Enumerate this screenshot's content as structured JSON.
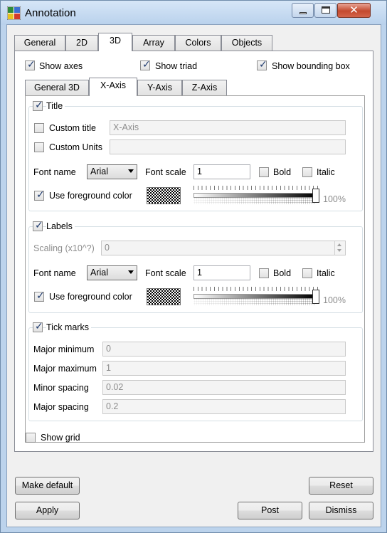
{
  "window": {
    "title": "Annotation",
    "close_symbol": "✕"
  },
  "outer_tabs": [
    "General",
    "2D",
    "3D",
    "Array",
    "Colors",
    "Objects"
  ],
  "show_axes": {
    "label": "Show axes",
    "checked": true
  },
  "show_triad": {
    "label": "Show triad",
    "checked": true
  },
  "show_bbox": {
    "label": "Show bounding box",
    "checked": true
  },
  "inner_tabs": [
    "General 3D",
    "X-Axis",
    "Y-Axis",
    "Z-Axis"
  ],
  "title_group": {
    "label": "Title",
    "custom_title_label": "Custom title",
    "custom_title_value": "X-Axis",
    "custom_units_label": "Custom Units",
    "custom_units_value": "",
    "font_name_label": "Font name",
    "font_name_value": "Arial",
    "font_scale_label": "Font scale",
    "font_scale_value": "1",
    "bold_label": "Bold",
    "italic_label": "Italic",
    "use_fg_label": "Use foreground color",
    "opacity_text": "100%",
    "opacity_value": 1.0
  },
  "labels_group": {
    "label": "Labels",
    "scaling_label": "Scaling (x10^?)",
    "scaling_value": "0",
    "font_name_label": "Font name",
    "font_name_value": "Arial",
    "font_scale_label": "Font scale",
    "font_scale_value": "1",
    "bold_label": "Bold",
    "italic_label": "Italic",
    "use_fg_label": "Use foreground color",
    "opacity_text": "100%",
    "opacity_value": 1.0
  },
  "tick_group": {
    "label": "Tick marks",
    "major_min_label": "Major minimum",
    "major_min_value": "0",
    "major_max_label": "Major maximum",
    "major_max_value": "1",
    "minor_spacing_label": "Minor spacing",
    "minor_spacing_value": "0.02",
    "major_spacing_label": "Major spacing",
    "major_spacing_value": "0.2"
  },
  "show_grid": {
    "label": "Show grid",
    "checked": false
  },
  "buttons": {
    "make_default": "Make default",
    "reset": "Reset",
    "apply": "Apply",
    "post": "Post",
    "dismiss": "Dismiss"
  },
  "check_glyph": "✓"
}
